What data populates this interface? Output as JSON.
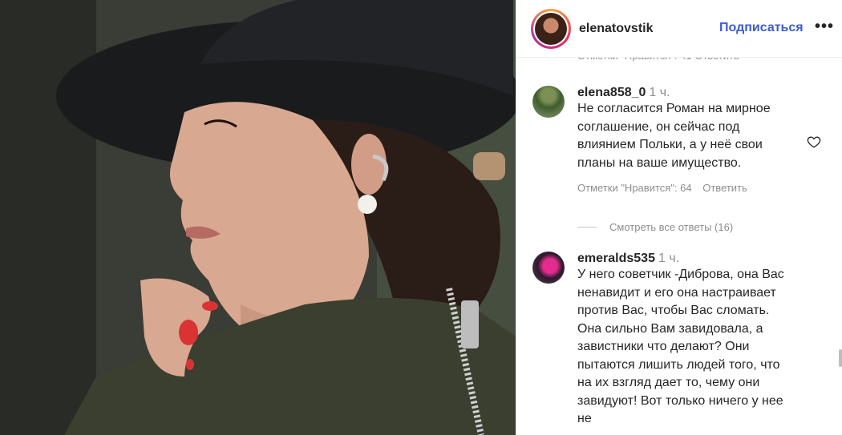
{
  "post": {
    "username": "elenatovstik",
    "follow_label": "Подписаться",
    "more_label": "•••"
  },
  "cut_off_meta": "Отметки \"Нравится\": 41   Ответить",
  "comments": [
    {
      "username": "elena858_0",
      "time": "1 ч.",
      "text": "Не согласится Роман на мирное соглашение, он сейчас под влиянием Польки, а у неё свои планы на ваше имущество.",
      "likes": "Отметки \"Нравится\": 64",
      "reply_label": "Ответить",
      "view_replies": "Смотреть все ответы (16)"
    },
    {
      "username": "emeralds535",
      "time": "1 ч.",
      "text": "У него советчик -Диброва, она Вас ненавидит и его она настраивает против Вас, чтобы Вас сломать. Она сильно Вам завидовала, а завистники что делают? Они пытаются лишить людей того, что на их взгляд дает то, чему они завидуют! Вот только ничего у нее не"
    }
  ],
  "icons": {
    "like": "heart-icon",
    "more": "more-options-icon"
  }
}
